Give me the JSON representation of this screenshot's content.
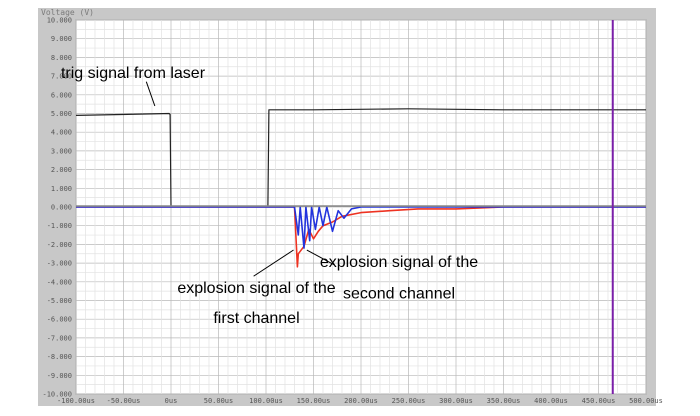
{
  "chart_data": {
    "type": "line",
    "ylabel": "Voltage (V)",
    "ylim": [
      -10,
      10
    ],
    "xlim": [
      -100,
      500
    ],
    "x_unit": "us",
    "yticks": [
      "10.000",
      "9.000",
      "8.000",
      "7.000",
      "6.000",
      "5.000",
      "4.000",
      "3.000",
      "2.000",
      "1.000",
      "0.000",
      "-1.000",
      "-2.000",
      "-3.000",
      "-4.000",
      "-5.000",
      "-6.000",
      "-7.000",
      "-8.000",
      "-9.000",
      "-10.000"
    ],
    "xticks": [
      "-100.00us",
      "-50.00us",
      "0us",
      "50.00us",
      "100.00us",
      "150.00us",
      "200.00us",
      "250.00us",
      "300.00us",
      "350.00us",
      "400.00us",
      "450.00us",
      "500.00us"
    ],
    "grid": true,
    "cursor_x": 465,
    "series": [
      {
        "color": "#222222",
        "x": [
          -100,
          -2,
          -1,
          0,
          100,
          102,
          103,
          150,
          250,
          350,
          450,
          500
        ],
        "y": [
          4.9,
          5.0,
          4.95,
          0.05,
          0.05,
          0.05,
          5.2,
          5.2,
          5.25,
          5.2,
          5.2,
          5.2
        ]
      },
      {
        "color": "#ee3322",
        "x": [
          -100,
          100,
          130,
          133,
          134,
          140,
          145,
          150,
          155,
          160,
          170,
          180,
          200,
          230,
          260,
          300,
          350,
          400,
          450,
          500
        ],
        "y": [
          0,
          0,
          0,
          -3.2,
          -2.5,
          -2.1,
          -1.2,
          -1.7,
          -1.3,
          -1.0,
          -0.8,
          -0.5,
          -0.3,
          -0.2,
          -0.1,
          -0.1,
          0,
          0,
          0,
          0
        ]
      },
      {
        "color": "#2233dd",
        "x": [
          -100,
          100,
          130,
          134,
          136,
          140,
          142,
          146,
          148,
          152,
          156,
          160,
          164,
          170,
          176,
          182,
          190,
          200,
          230,
          300,
          500
        ],
        "y": [
          0,
          0,
          0,
          -1.5,
          0,
          -2.2,
          0,
          -1.8,
          0,
          -1.2,
          0,
          -1.0,
          0,
          -1.3,
          -0.2,
          -0.6,
          -0.1,
          0,
          0,
          0,
          0
        ]
      },
      {
        "color": "#888888",
        "x": [
          -100,
          500
        ],
        "y": [
          0.05,
          0.05
        ]
      }
    ],
    "annotations": [
      {
        "text": "trig signal from laser",
        "x": -40,
        "y": 6.9
      },
      {
        "text": "explosion signal of the",
        "x": 90,
        "y": -4.6
      },
      {
        "text": "first channel",
        "x": 90,
        "y": -6.2
      },
      {
        "text": "explosion signal of the",
        "x": 240,
        "y": -3.2
      },
      {
        "text": "second channel",
        "x": 240,
        "y": -4.9
      }
    ]
  }
}
